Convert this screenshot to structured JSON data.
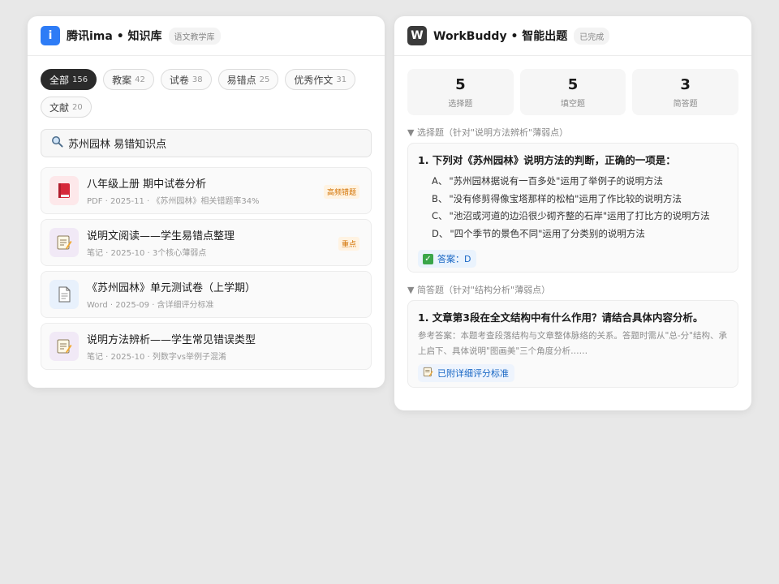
{
  "left": {
    "logo_letter": "i",
    "title": "腾讯ima • 知识库",
    "badge": "语文教学库",
    "colors": {
      "logo": "#2e7cf6",
      "active_chip": "#2b2b2b",
      "tag_text": "#d27100"
    },
    "filters": [
      {
        "label": "全部",
        "count": "156",
        "active": true
      },
      {
        "label": "教案",
        "count": "42"
      },
      {
        "label": "试卷",
        "count": "38"
      },
      {
        "label": "易错点",
        "count": "25"
      },
      {
        "label": "优秀作文",
        "count": "31"
      },
      {
        "label": "文献",
        "count": "20"
      }
    ],
    "search": {
      "icon": "search-icon",
      "value": "苏州园林 易错知识点"
    },
    "docs": [
      {
        "icon": "red-book-icon",
        "title": "八年级上册 期中试卷分析",
        "meta": "PDF · 2025-11 · 《苏州园林》相关错题率34%",
        "tag": "高频错题"
      },
      {
        "icon": "memo-icon",
        "title": "说明文阅读——学生易错点整理",
        "meta": "笔记 · 2025-10 · 3个核心薄弱点",
        "tag": "重点"
      },
      {
        "icon": "document-icon",
        "title": "《苏州园林》单元测试卷（上学期）",
        "meta": "Word · 2025-09 · 含详细评分标准",
        "tag": ""
      },
      {
        "icon": "memo-icon",
        "title": "说明方法辨析——学生常见错误类型",
        "meta": "笔记 · 2025-10 · 列数字vs举例子混淆",
        "tag": ""
      }
    ]
  },
  "right": {
    "logo_letter": "W",
    "title": "WorkBuddy • 智能出题",
    "badge": "已完成",
    "colors": {
      "logo": "#3a3a3a",
      "answer_text": "#1766c4",
      "check": "#3aa64a"
    },
    "stats": [
      {
        "num": "5",
        "label": "选择题"
      },
      {
        "num": "5",
        "label": "填空题"
      },
      {
        "num": "3",
        "label": "简答题"
      }
    ],
    "section1": "▼ 选择题（针对\"说明方法辨析\"薄弱点）",
    "q1": {
      "title": "1. 下列对《苏州园林》说明方法的判断，正确的一项是：",
      "options": [
        {
          "letter": "A、",
          "text": "\"苏州园林据说有一百多处\"运用了举例子的说明方法"
        },
        {
          "letter": "B、",
          "text": "\"没有修剪得像宝塔那样的松柏\"运用了作比较的说明方法"
        },
        {
          "letter": "C、",
          "text": "\"池沼或河道的边沿很少砌齐整的石岸\"运用了打比方的说明方法"
        },
        {
          "letter": "D、",
          "text": "\"四个季节的景色不同\"运用了分类别的说明方法"
        }
      ],
      "answer": "答案：D"
    },
    "section2": "▼ 简答题（针对\"结构分析\"薄弱点）",
    "q2": {
      "title": "1. 文章第3段在全文结构中有什么作用？请结合具体内容分析。",
      "reference": "参考答案：本题考查段落结构与文章整体脉络的关系。答题时需从\"总-分\"结构、承上启下、具体说明\"图画美\"三个角度分析……",
      "rubric": "已附详细评分标准"
    }
  }
}
